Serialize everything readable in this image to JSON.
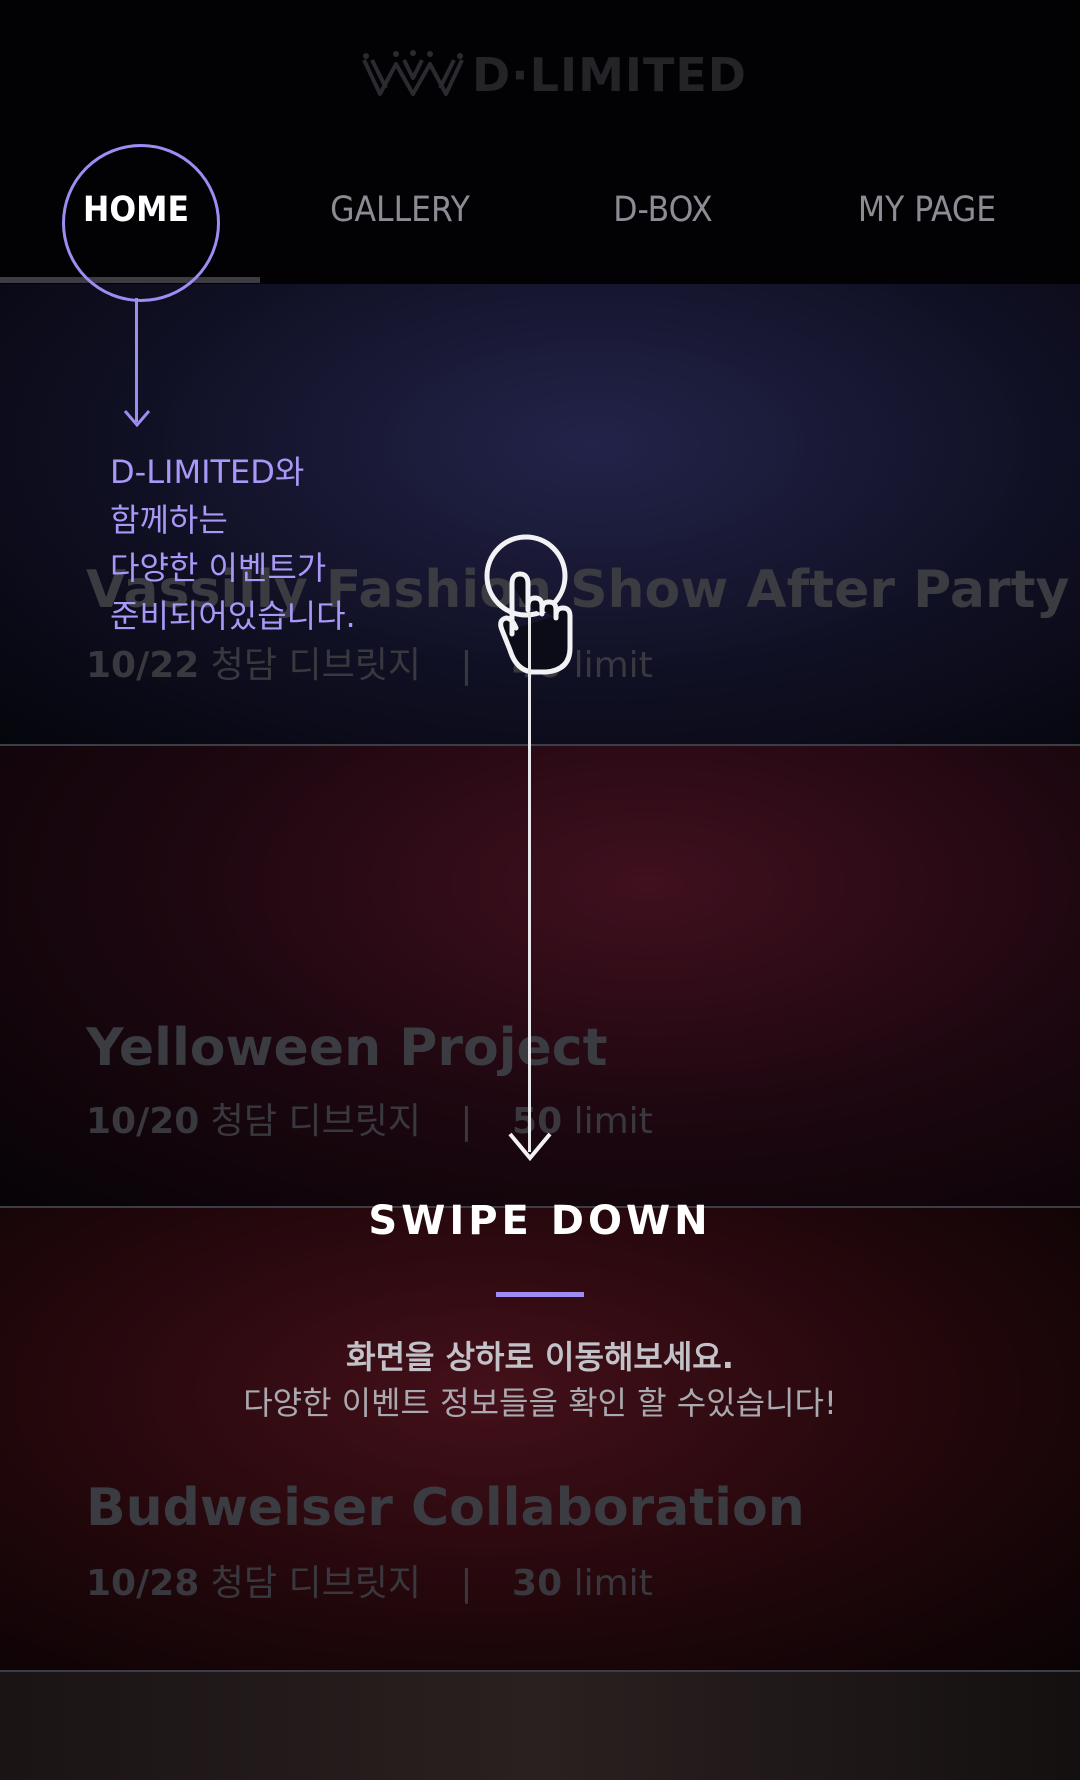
{
  "brand": {
    "name": "D·LIMITED",
    "logo_icon": "crown-icon"
  },
  "nav": {
    "items": [
      {
        "label": "HOME",
        "active": true
      },
      {
        "label": "GALLERY",
        "active": false
      },
      {
        "label": "D-BOX",
        "active": false
      },
      {
        "label": "MY PAGE",
        "active": false
      }
    ]
  },
  "events": [
    {
      "title": "Vassilly Fashion Show After Party",
      "date": "10/22",
      "venue": "청담 디브릿지",
      "separator": "|",
      "capacity": "40",
      "unit": "limit",
      "tint": "#1a1a3c"
    },
    {
      "title": "Yelloween Project",
      "date": "10/20",
      "venue": "청담 디브릿지",
      "separator": "|",
      "capacity": "50",
      "unit": "limit",
      "tint": "#3a0d1c"
    },
    {
      "title": "Budweiser Collaboration",
      "date": "10/28",
      "venue": "청담 디브릿지",
      "separator": "|",
      "capacity": "30",
      "unit": "limit",
      "tint": "#3d0b0e"
    }
  ],
  "tutorial": {
    "home_tip": [
      "D-LIMITED와",
      "함께하는",
      "다양한 이벤트가",
      "준비되어있습니다."
    ],
    "swipe_title": "SWIPE DOWN",
    "swipe_sub1": "화면을 상하로 이동해보세요.",
    "swipe_sub2": "다양한 이벤트 정보들을 확인 할 수있습니다!",
    "gesture_icon": "hand-tap-icon",
    "accent_color": "#9d8cf2"
  }
}
